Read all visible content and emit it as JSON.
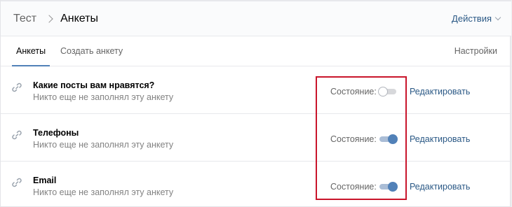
{
  "breadcrumb": {
    "root": "Тест",
    "current": "Анкеты"
  },
  "header": {
    "actions_label": "Действия"
  },
  "tabs": [
    {
      "label": "Анкеты",
      "active": true
    },
    {
      "label": "Создать анкету",
      "active": false
    }
  ],
  "settings_label": "Настройки",
  "forms": [
    {
      "title": "Какие посты вам нравятся?",
      "subtitle": "Никто еще не заполнял эту анкету",
      "status_label": "Состояние:",
      "enabled": false,
      "edit_label": "Редактировать"
    },
    {
      "title": "Телефоны",
      "subtitle": "Никто еще не заполнял эту анкету",
      "status_label": "Состояние:",
      "enabled": true,
      "edit_label": "Редактировать"
    },
    {
      "title": "Email",
      "subtitle": "Никто еще не заполнял эту анкету",
      "status_label": "Состояние:",
      "enabled": true,
      "edit_label": "Редактировать"
    }
  ],
  "colors": {
    "accent": "#5181b8",
    "link": "#2a5885",
    "highlight": "#c9152b"
  }
}
